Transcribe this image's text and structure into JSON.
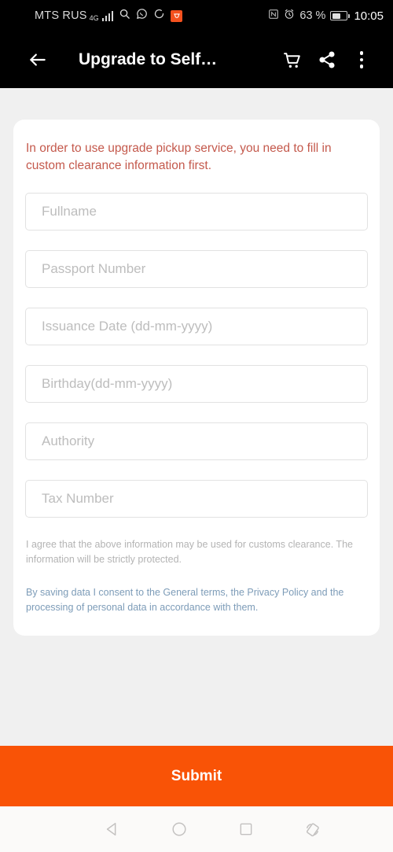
{
  "status_bar": {
    "carrier": "MTS RUS",
    "network_type": "4G",
    "icons": [
      "signal-bars-icon",
      "search-icon",
      "whatsapp-icon",
      "circle-sync-icon",
      "app-badge-icon",
      "nfc-icon",
      "alarm-clock-icon"
    ],
    "battery_percent": "63 %",
    "battery_level": 62,
    "time": "10:05"
  },
  "app_bar": {
    "back_icon": "back-arrow-icon",
    "title": "Upgrade to Self…",
    "cart_icon": "shopping-cart-icon",
    "share_icon": "share-icon",
    "overflow_icon": "more-vertical-icon"
  },
  "card": {
    "notice": "In order to use upgrade pickup service, you need to fill in custom clearance information first.",
    "fields": [
      {
        "name": "fullname",
        "placeholder": "Fullname",
        "value": ""
      },
      {
        "name": "passport-number",
        "placeholder": "Passport Number",
        "value": ""
      },
      {
        "name": "issuance-date",
        "placeholder": "Issuance Date (dd-mm-yyyy)",
        "value": ""
      },
      {
        "name": "birthday",
        "placeholder": "Birthday(dd-mm-yyyy)",
        "value": ""
      },
      {
        "name": "authority",
        "placeholder": "Authority",
        "value": ""
      },
      {
        "name": "tax-number",
        "placeholder": "Tax Number",
        "value": ""
      }
    ],
    "agree_text": "I agree that the above information may be used for customs clearance. The information will be strictly protected.",
    "consent_text": "By saving data I consent to the General terms, the Privacy Policy and the processing of personal data in accordance with them."
  },
  "submit": {
    "label": "Submit"
  },
  "nav_bar": {
    "back_icon": "nav-back-triangle-icon",
    "home_icon": "nav-home-circle-icon",
    "recents_icon": "nav-recents-square-icon",
    "rotate_icon": "nav-rotate-screen-icon"
  },
  "colors": {
    "accent_orange": "#f95306",
    "notice_red": "#c4594c",
    "consent_blue": "#7d9cb8",
    "page_background": "#f0f0f0",
    "bar_background": "#000000"
  }
}
